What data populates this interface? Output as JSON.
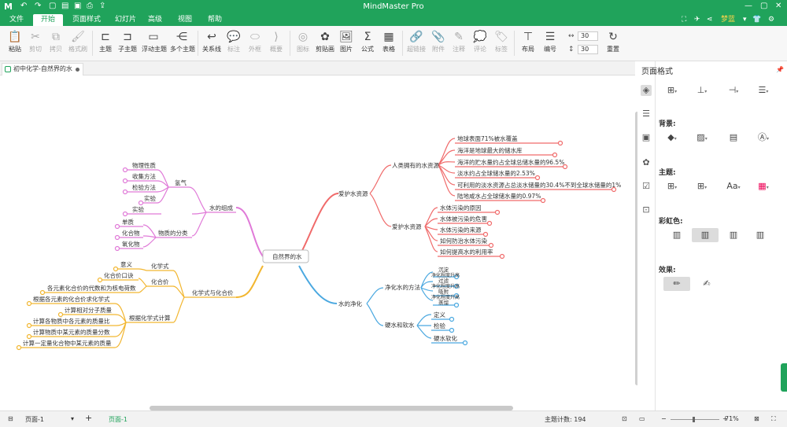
{
  "app": {
    "title": "MindMaster Pro",
    "logo": "M"
  },
  "menu": {
    "tabs": [
      "文件",
      "开始",
      "页面样式",
      "幻灯片",
      "高级",
      "视图",
      "帮助"
    ],
    "active": "开始",
    "user": "梦蓝"
  },
  "ribbon": {
    "buttons": [
      {
        "label": "粘贴",
        "icon": "paste-icon",
        "glyph": "📋",
        "enabled": true
      },
      {
        "label": "剪切",
        "icon": "cut-icon",
        "glyph": "✂",
        "enabled": false
      },
      {
        "label": "拷贝",
        "icon": "copy-icon",
        "glyph": "⧉",
        "enabled": false
      },
      {
        "label": "格式刷",
        "icon": "format-painter-icon",
        "glyph": "🖌",
        "enabled": false
      },
      {
        "label": "主题",
        "icon": "topic-icon",
        "glyph": "⊏",
        "enabled": true
      },
      {
        "label": "子主题",
        "icon": "subtopic-icon",
        "glyph": "⊐",
        "enabled": true
      },
      {
        "label": "浮动主题",
        "icon": "floating-topic-icon",
        "glyph": "▭",
        "enabled": true
      },
      {
        "label": "多个主题",
        "icon": "multiple-topics-icon",
        "glyph": "⋲",
        "enabled": true
      },
      {
        "label": "关系线",
        "icon": "relationship-icon",
        "glyph": "↩",
        "enabled": true
      },
      {
        "label": "标注",
        "icon": "callout-icon",
        "glyph": "💬",
        "enabled": false
      },
      {
        "label": "外框",
        "icon": "boundary-icon",
        "glyph": "⬭",
        "enabled": false
      },
      {
        "label": "概要",
        "icon": "summary-icon",
        "glyph": "⟩",
        "enabled": false
      },
      {
        "label": "图标",
        "icon": "mark-icon",
        "glyph": "◎",
        "enabled": false
      },
      {
        "label": "剪贴画",
        "icon": "clipart-icon",
        "glyph": "✿",
        "enabled": true
      },
      {
        "label": "图片",
        "icon": "image-icon",
        "glyph": "🖼",
        "enabled": true
      },
      {
        "label": "公式",
        "icon": "formula-icon",
        "glyph": "Σ",
        "enabled": true
      },
      {
        "label": "表格",
        "icon": "table-icon",
        "glyph": "▦",
        "enabled": true
      },
      {
        "label": "超链接",
        "icon": "hyperlink-icon",
        "glyph": "🔗",
        "enabled": false
      },
      {
        "label": "附件",
        "icon": "attachment-icon",
        "glyph": "📎",
        "enabled": false
      },
      {
        "label": "注释",
        "icon": "note-icon",
        "glyph": "✎",
        "enabled": false
      },
      {
        "label": "评论",
        "icon": "comment-icon",
        "glyph": "💭",
        "enabled": false
      },
      {
        "label": "标签",
        "icon": "tag-icon",
        "glyph": "🏷",
        "enabled": false
      },
      {
        "label": "布局",
        "icon": "layout-icon",
        "glyph": "⊤",
        "enabled": true
      },
      {
        "label": "编号",
        "icon": "numbering-icon",
        "glyph": "☰",
        "enabled": true
      },
      {
        "label": "重置",
        "icon": "reset-icon",
        "glyph": "↻",
        "enabled": true
      }
    ],
    "spin1": "30",
    "spin2": "30"
  },
  "document": {
    "tab_title": "初中化学-自然界的水"
  },
  "mindmap": {
    "root": "自然界的水",
    "nodes": {
      "n_protect": "爱护水资源",
      "n_human": "人类拥有的水资源",
      "n_h1": "地球表面71%被水覆盖",
      "n_h2": "海洋是地球最大的储水库",
      "n_h3": "海洋的贮水量约占全球总储水量的96.5%",
      "n_h4": "淡水约占全球储水量的2.53%",
      "n_h5": "可利用的淡水资源占总淡水储量的30.4%不到全球水储量的1%",
      "n_h6": "陆地咸水占全球储水量的0.97%",
      "n_protect2": "爱护水资源",
      "n_p1": "水体污染的原因",
      "n_p2": "水体被污染的危害",
      "n_p3": "水体污染的来源",
      "n_p4": "如何防治水体污染",
      "n_p5": "如何提高水的利用率",
      "n_purify": "水的净化",
      "n_method": "净化水的方法",
      "n_m1": "沉淀",
      "n_m2": "净化程度升高",
      "n_m3": "过滤",
      "n_m4": "净化程度升高",
      "n_m5": "吸附",
      "n_m6": "净化程度升高",
      "n_m7": "蒸馏",
      "n_hard": "硬水和软水",
      "n_hd1": "定义",
      "n_hd2": "检验",
      "n_hd3": "硬水软化",
      "n_comp": "水的组成",
      "n_h2gas": "氢气",
      "n_g1": "物理性质",
      "n_g2": "收集方法",
      "n_g3": "检验方法",
      "n_g4": "实验",
      "n_exp": "实验",
      "n_class": "物质的分类",
      "n_c1": "单质",
      "n_c2": "化合物",
      "n_c3": "氧化物",
      "n_formula": "化学式与化合价",
      "n_chem": "化学式",
      "n_f1": "意义",
      "n_val": "化合价",
      "n_v1": "化合价口诀",
      "n_v2": "各元素化合价的代数和为核电荷数",
      "n_calc": "根据化学式计算",
      "n_k1": "根据各元素的化合价求化学式",
      "n_k2": "计算相对分子质量",
      "n_k3": "计算各物质中各元素的质量比",
      "n_k4": "计算物质中某元素的质量分数",
      "n_k5": "计算一定量化合物中某元素的质量"
    },
    "colors": {
      "protect": "#f06a6a",
      "purify": "#4aa8e0",
      "composition": "#e07ad8",
      "formula": "#f2b630",
      "root_border": "#bbbbbb"
    }
  },
  "panel": {
    "title": "页面格式",
    "background_label": "背景:",
    "theme_label": "主题:",
    "rainbow_label": "彩虹色:",
    "effect_label": "效果:"
  },
  "status": {
    "page_select": "页面-1",
    "page_tab": "页面-1",
    "topic_count": "主题计数: 194",
    "zoom": "71%"
  }
}
